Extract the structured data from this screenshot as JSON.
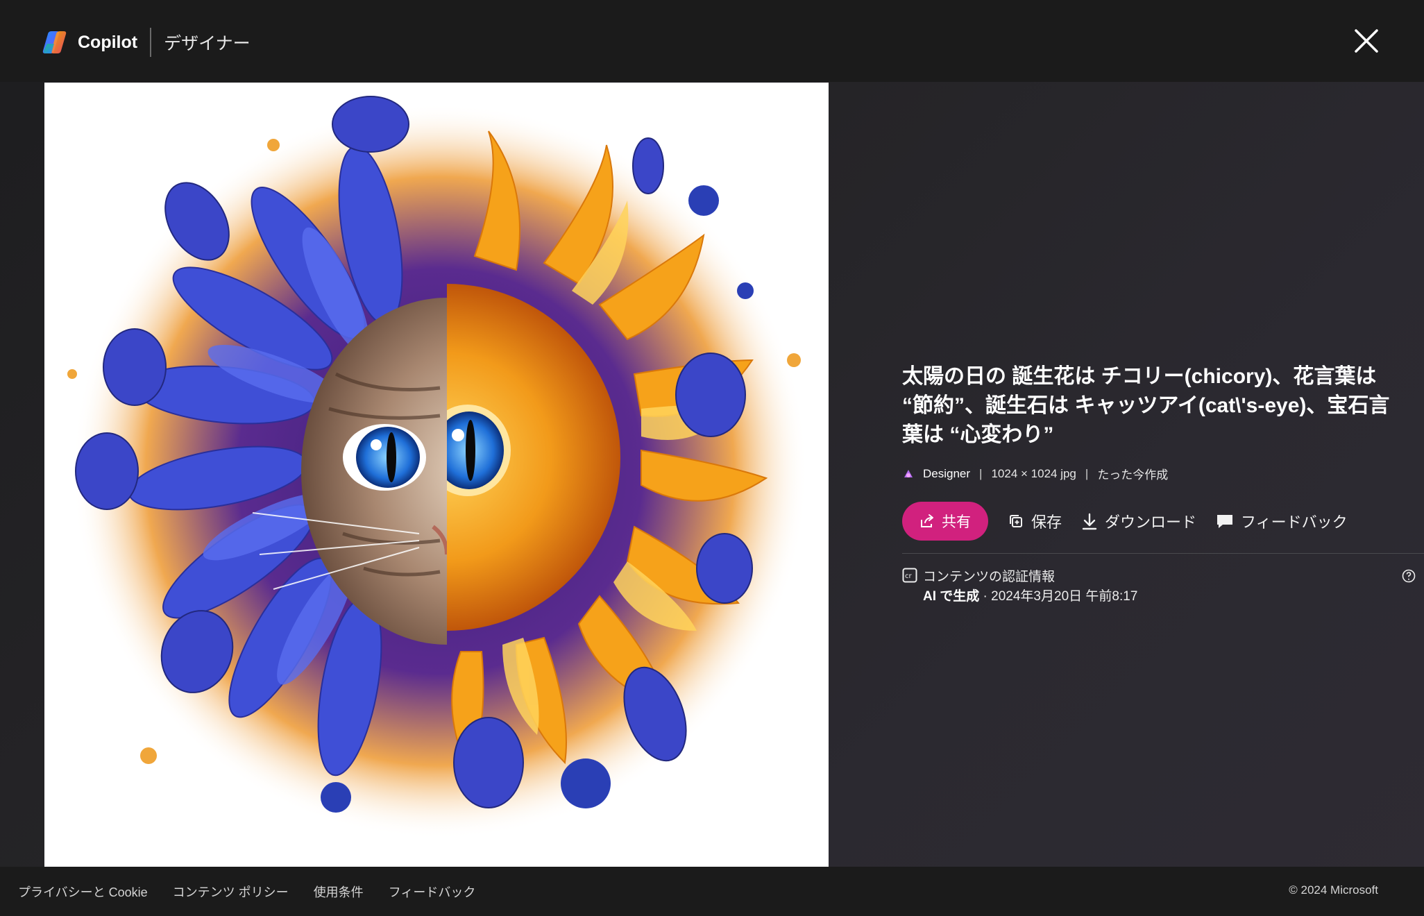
{
  "header": {
    "brand_name": "Copilot",
    "brand_sub": "デザイナー",
    "close_icon": "close-icon"
  },
  "image": {
    "description_icon": "generated-image"
  },
  "panel": {
    "title": "太陽の日の 誕生花は チコリー(chicory)、花言葉は “節約”、誕生石は キャッツアイ(cat\\'s-eye)、宝石言葉は “心変わり”",
    "meta": {
      "source": "Designer",
      "dimensions": "1024 × 1024 jpg",
      "created": "たった今作成"
    },
    "actions": {
      "share": "共有",
      "save": "保存",
      "download": "ダウンロード",
      "feedback": "フィードバック"
    },
    "credentials": {
      "title": "コンテンツの認証情報",
      "ai_label": "AI で生成",
      "date": " · 2024年3月20日 午前8:17"
    }
  },
  "footer": {
    "links": [
      "プライバシーと Cookie",
      "コンテンツ ポリシー",
      "使用条件",
      "フィードバック"
    ],
    "copyright": "© 2024 Microsoft"
  },
  "colors": {
    "accent": "#d1217e",
    "header_bg": "#1b1b1b"
  }
}
